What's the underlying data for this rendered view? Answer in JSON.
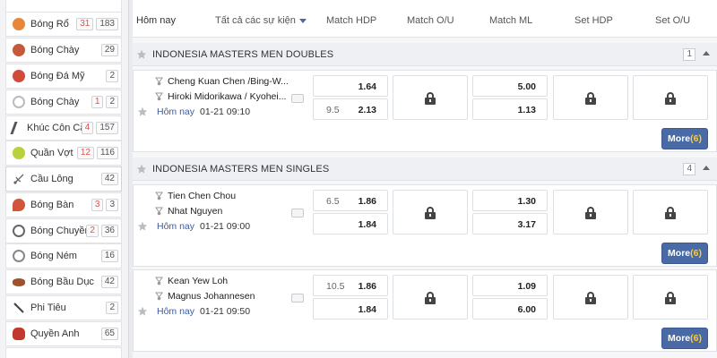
{
  "sidebar": {
    "items": [
      {
        "label": "Bóng Rổ",
        "live": "31",
        "count": "183",
        "icon": "basketball-icon",
        "color": "#e8873c"
      },
      {
        "label": "Bóng Chày",
        "live": "",
        "count": "29",
        "icon": "baseball-icon",
        "color": "#c45a3a"
      },
      {
        "label": "Bóng Đá Mỹ",
        "live": "",
        "count": "2",
        "icon": "american-football-icon",
        "color": "#d24a3a"
      },
      {
        "label": "Bóng Chày",
        "live": "1",
        "count": "2",
        "icon": "baseball-icon",
        "color": "#cfcfcf"
      },
      {
        "label": "Khúc Côn Cầu",
        "live": "4",
        "count": "157",
        "icon": "hockey-icon",
        "color": "#555555"
      },
      {
        "label": "Quần Vợt",
        "live": "12",
        "count": "116",
        "icon": "tennis-icon",
        "color": "#b7d23a"
      },
      {
        "label": "Cầu Lông",
        "live": "",
        "count": "42",
        "icon": "badminton-icon",
        "color": "#777777"
      },
      {
        "label": "Bóng Bàn",
        "live": "3",
        "count": "3",
        "icon": "table-tennis-icon",
        "color": "#d0553a"
      },
      {
        "label": "Bóng Chuyền",
        "live": "2",
        "count": "36",
        "icon": "volleyball-icon",
        "color": "#666666"
      },
      {
        "label": "Bóng Ném",
        "live": "",
        "count": "16",
        "icon": "handball-icon",
        "color": "#888888"
      },
      {
        "label": "Bóng Bầu Dục",
        "live": "",
        "count": "42",
        "icon": "rugby-icon",
        "color": "#a0522d"
      },
      {
        "label": "Phi Tiêu",
        "live": "",
        "count": "2",
        "icon": "darts-icon",
        "color": "#444444"
      },
      {
        "label": "Quyền Anh",
        "live": "",
        "count": "65",
        "icon": "boxing-icon",
        "color": "#c0392b"
      }
    ]
  },
  "topbar": {
    "today": "Hôm nay",
    "all_events": "Tất cả các sự kiện",
    "col_match_hdp": "Match HDP",
    "col_match_ou": "Match O/U",
    "col_match_ml": "Match ML",
    "col_set_hdp": "Set HDP",
    "col_set_ou": "Set O/U"
  },
  "leagues": [
    {
      "name": "INDONESIA MASTERS MEN DOUBLES",
      "count": "1",
      "matches": [
        {
          "home": "Cheng Kuan Chen /Bing-W...",
          "away": "Hiroki Midorikawa / Kyohei...",
          "today": "Hôm nay",
          "time": "01-21 09:10",
          "hdp": [
            {
              "line": "",
              "price": "1.64"
            },
            {
              "line": "9.5",
              "price": "2.13"
            }
          ],
          "ml": [
            "5.00",
            "1.13"
          ],
          "more_label": "More",
          "more_count": "(6)"
        }
      ]
    },
    {
      "name": "INDONESIA MASTERS MEN SINGLES",
      "count": "4",
      "matches": [
        {
          "home": "Tien Chen Chou",
          "away": "Nhat Nguyen",
          "today": "Hôm nay",
          "time": "01-21 09:00",
          "hdp": [
            {
              "line": "6.5",
              "price": "1.86"
            },
            {
              "line": "",
              "price": "1.84"
            }
          ],
          "ml": [
            "1.30",
            "3.17"
          ],
          "more_label": "More",
          "more_count": "(6)"
        },
        {
          "home": "Kean Yew Loh",
          "away": "Magnus Johannesen",
          "today": "Hôm nay",
          "time": "01-21 09:50",
          "hdp": [
            {
              "line": "10.5",
              "price": "1.86"
            },
            {
              "line": "",
              "price": "1.84"
            }
          ],
          "ml": [
            "1.09",
            "6.00"
          ],
          "more_label": "More",
          "more_count": "(6)"
        }
      ]
    }
  ],
  "colors": {
    "accent": "#4a6aa5",
    "more_count": "#ffcc33",
    "today_link": "#3a5ba8"
  }
}
